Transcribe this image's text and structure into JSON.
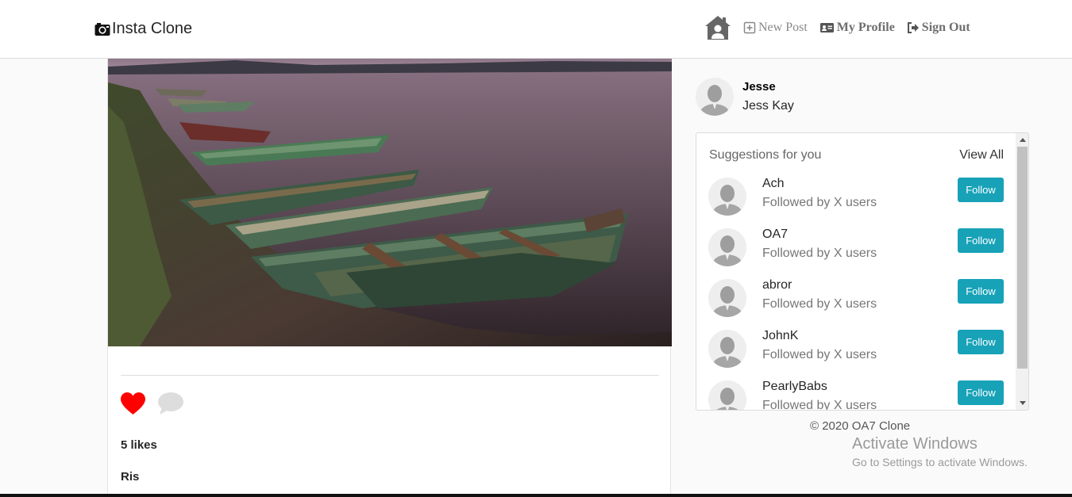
{
  "navbar": {
    "brand": "Insta Clone",
    "new_post": "New Post",
    "my_profile": "My Profile",
    "sign_out": "Sign Out",
    "icons": [
      "camera-icon",
      "home-icon",
      "plus-square-icon",
      "id-card-icon",
      "sign-out-icon"
    ]
  },
  "post": {
    "likes": "5 likes",
    "author": "Ris",
    "liked": true,
    "colors": {
      "heart": "#ff0000",
      "comment": "#dddddd"
    }
  },
  "profile": {
    "username": "Jesse",
    "name": "Jess Kay"
  },
  "suggestions": {
    "title": "Suggestions for you",
    "view_all": "View All",
    "items": [
      {
        "name": "Ach",
        "subtitle": "Followed by X users",
        "button": "Follow"
      },
      {
        "name": "OA7",
        "subtitle": "Followed by X users",
        "button": "Follow"
      },
      {
        "name": "abror",
        "subtitle": "Followed by X users",
        "button": "Follow"
      },
      {
        "name": "JohnK",
        "subtitle": "Followed by X users",
        "button": "Follow"
      },
      {
        "name": "PearlyBabs",
        "subtitle": "Followed by X users",
        "button": "Follow"
      }
    ],
    "button_color": "#17a2b8"
  },
  "footer": {
    "copyright": "© 2020 OA7 Clone"
  },
  "watermark": {
    "title": "Activate Windows",
    "subtitle": "Go to Settings to activate Windows."
  }
}
